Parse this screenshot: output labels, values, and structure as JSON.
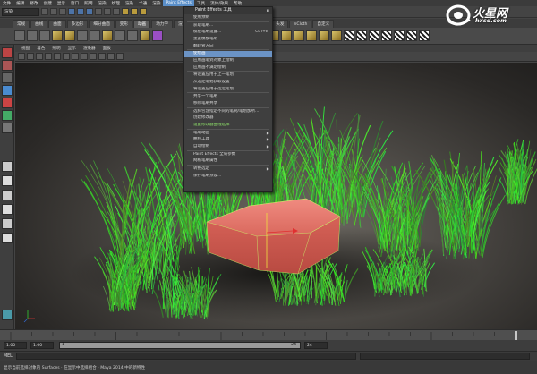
{
  "menubar": {
    "items": [
      "文件",
      "编辑",
      "修改",
      "创建",
      "显示",
      "窗口",
      "照明",
      "渲染",
      "纹理",
      "渲染",
      "卡通",
      "渲染",
      "Paint Effects",
      "工具",
      "流体/效果",
      "帮助"
    ],
    "active_index": 12
  },
  "statusline": {
    "mode": "渲染"
  },
  "shelf_tabs": [
    "常规",
    "曲线",
    "曲面",
    "多边形",
    "细分曲面",
    "变形",
    "动画",
    "动力学",
    "渲染",
    "PaintEff",
    "卡通",
    "肌肉",
    "流体",
    "头发",
    "nCloth",
    "自定义"
  ],
  "shelf_tab_active_index": 6,
  "panel_menu": [
    "视图",
    "着色",
    "照明",
    "显示",
    "渲染器",
    "面板"
  ],
  "dropdown": {
    "title": "Paint Effects 工具",
    "items": [
      {
        "label": "使用预制",
        "kb": "",
        "arrow": false
      },
      {
        "label": "获取笔刷...",
        "kb": "",
        "arrow": false
      },
      {
        "label": "模板笔刷设置...",
        "kb": "Ctrl+B",
        "arrow": false
      },
      {
        "label": "重置模板笔刷",
        "kb": "",
        "arrow": false
      },
      {
        "label": "翻转管方向",
        "kb": "",
        "arrow": false
      },
      {
        "label": "使绘画",
        "kb": "",
        "arrow": false,
        "highlight": true
      },
      {
        "label": "应用画笔到对象上绘制",
        "kb": "",
        "arrow": false
      },
      {
        "label": "应用画不满足绘制",
        "kb": "",
        "arrow": false
      },
      {
        "label": "将设置应用于上一笔划",
        "kb": "",
        "arrow": false
      },
      {
        "label": "从选定笔划获取设置",
        "kb": "",
        "arrow": false
      },
      {
        "label": "将设置应用于选定笔划",
        "kb": "",
        "arrow": false
      },
      {
        "label": "共享一个笔刷",
        "kb": "",
        "arrow": false
      },
      {
        "label": "移除笔刷共享",
        "kb": "",
        "arrow": false
      },
      {
        "label": "选择包含指定不同的笔刷/笔划加所...",
        "kb": "",
        "arrow": false
      },
      {
        "label": "创建修改器",
        "kb": "",
        "arrow": false
      },
      {
        "label": "设置修改器曲线选择",
        "kb": "",
        "arrow": false,
        "green": true
      },
      {
        "label": "笔刷动画",
        "kb": "",
        "arrow": true
      },
      {
        "label": "曲线工具",
        "kb": "",
        "arrow": true
      },
      {
        "label": "自动绘制",
        "kb": "",
        "arrow": true
      },
      {
        "label": "Paint Effects 全局参数",
        "kb": "",
        "arrow": false
      },
      {
        "label": "网格笔刷属性",
        "kb": "",
        "arrow": false
      },
      {
        "label": "转换选定",
        "kb": "",
        "arrow": true
      },
      {
        "label": "保存笔刷预设...",
        "kb": "",
        "arrow": false
      }
    ]
  },
  "watermark": {
    "name": "火星网",
    "url": "hxsd.com"
  },
  "timeline": {
    "start": "1.00",
    "end": "1.00",
    "range_start": "1",
    "range_end": "24",
    "current": "24"
  },
  "cmdline": {
    "label": "MEL"
  },
  "helpline": {
    "text": "显示当前选择对象的 Surfaces · 在显示中选择组合 · Maya 2014 中的新特性"
  },
  "colors": {
    "menu_active": "#5a8fc9",
    "highlight": "#6b93c5",
    "rock": "#e0675c",
    "grass": "#4fbf3d"
  }
}
